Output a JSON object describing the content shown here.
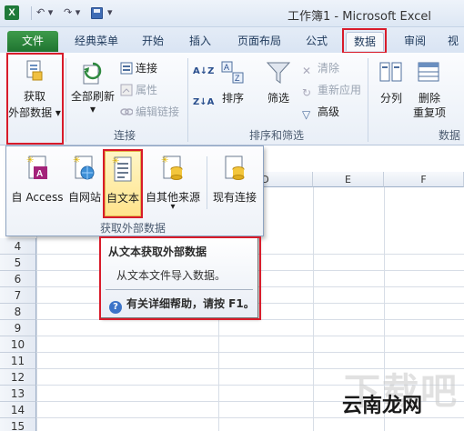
{
  "window": {
    "title": "工作簿1 - Microsoft Excel",
    "app_icon_letter": "X"
  },
  "quick_access": {
    "undo": "↶ ▾",
    "redo": "↷ ▾",
    "customize": "▾"
  },
  "tabs": [
    {
      "label": "文件"
    },
    {
      "label": "经典菜单"
    },
    {
      "label": "开始"
    },
    {
      "label": "插入"
    },
    {
      "label": "页面布局"
    },
    {
      "label": "公式"
    },
    {
      "label": "数据"
    },
    {
      "label": "审阅"
    },
    {
      "label": "视"
    }
  ],
  "ribbon": {
    "get_external": {
      "label_line1": "获取",
      "label_line2": "外部数据",
      "arrow": "▾"
    },
    "connections": {
      "refresh_all": {
        "label": "全部刷新",
        "arrow": "▾"
      },
      "connections_btn": "连接",
      "properties_btn": "属性",
      "edit_links_btn": "编辑链接",
      "group_label": "连接"
    },
    "sort_filter": {
      "sort_az": "A↓Z",
      "sort_za": "Z↓A",
      "sort_btn": "排序",
      "filter_btn": "筛选",
      "clear_btn": "清除",
      "reapply_btn": "重新应用",
      "advanced_btn": "高级",
      "group_label": "排序和筛选"
    },
    "data_tools": {
      "split_btn": "分列",
      "remove_dup_line1": "删除",
      "remove_dup_line2": "重复项",
      "group_label": "数据"
    }
  },
  "dropdown": {
    "items": [
      {
        "label": "自 Access"
      },
      {
        "label": "自网站"
      },
      {
        "label": "自文本"
      },
      {
        "label": "自其他来源",
        "arrow": "▾"
      },
      {
        "label": "现有连接"
      }
    ],
    "group_label": "获取外部数据"
  },
  "tooltip": {
    "title": "从文本获取外部数据",
    "body": "从文本文件导入数据。",
    "help": "有关详细帮助，请按 F1。",
    "help_icon": "?"
  },
  "sheet": {
    "columns": [
      "D",
      "E",
      "F"
    ],
    "rows": [
      "4",
      "5",
      "6",
      "7",
      "8",
      "9",
      "10",
      "11",
      "12",
      "13",
      "14",
      "15"
    ]
  },
  "watermark": {
    "logo": "云南龙网",
    "faint": "下载吧"
  },
  "colors": {
    "highlight_red": "#d81b2a",
    "file_tab_green": "#2a8a3b",
    "hover_yellow": "#ffe38c"
  }
}
